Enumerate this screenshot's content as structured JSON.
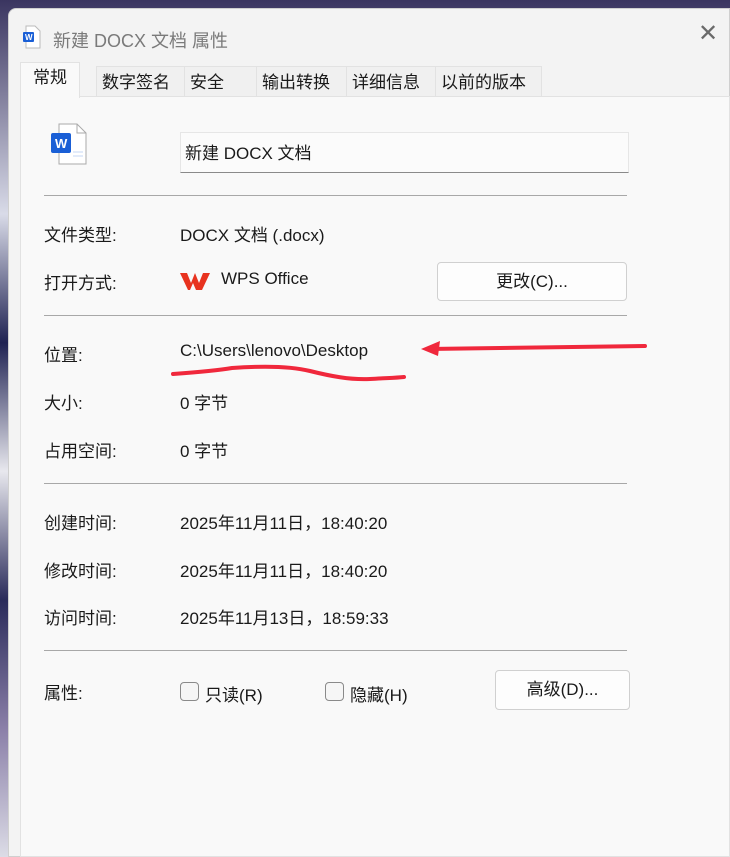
{
  "window": {
    "title": "新建 DOCX 文档 属性",
    "close_icon": "close-icon"
  },
  "tabs": [
    {
      "label": "常规",
      "active": true
    },
    {
      "label": "数字签名"
    },
    {
      "label": "安全"
    },
    {
      "label": "输出转换"
    },
    {
      "label": "详细信息"
    },
    {
      "label": "以前的版本"
    }
  ],
  "general": {
    "file_name": "新建 DOCX 文档",
    "file_type_label": "文件类型:",
    "file_type": "DOCX 文档 (.docx)",
    "open_with_label": "打开方式:",
    "open_with": "WPS Office",
    "change_button": "更改(C)...",
    "location_label": "位置:",
    "location": "C:\\Users\\lenovo\\Desktop",
    "size_label": "大小:",
    "size": "0 字节",
    "size_on_disk_label": "占用空间:",
    "size_on_disk": "0 字节",
    "created_label": "创建时间:",
    "created": "2025年11月11日，18:40:20",
    "modified_label": "修改时间:",
    "modified": "2025年11月11日，18:40:20",
    "accessed_label": "访问时间:",
    "accessed": "2025年11月13日，18:59:33",
    "attributes_label": "属性:",
    "readonly_label": "只读(R)",
    "readonly": false,
    "hidden_label": "隐藏(H)",
    "hidden": false,
    "advanced_button": "高级(D)..."
  },
  "colors": {
    "annotation": "#f0283c",
    "word_blue": "#1a5fd6",
    "wps_red": "#e8331f"
  }
}
